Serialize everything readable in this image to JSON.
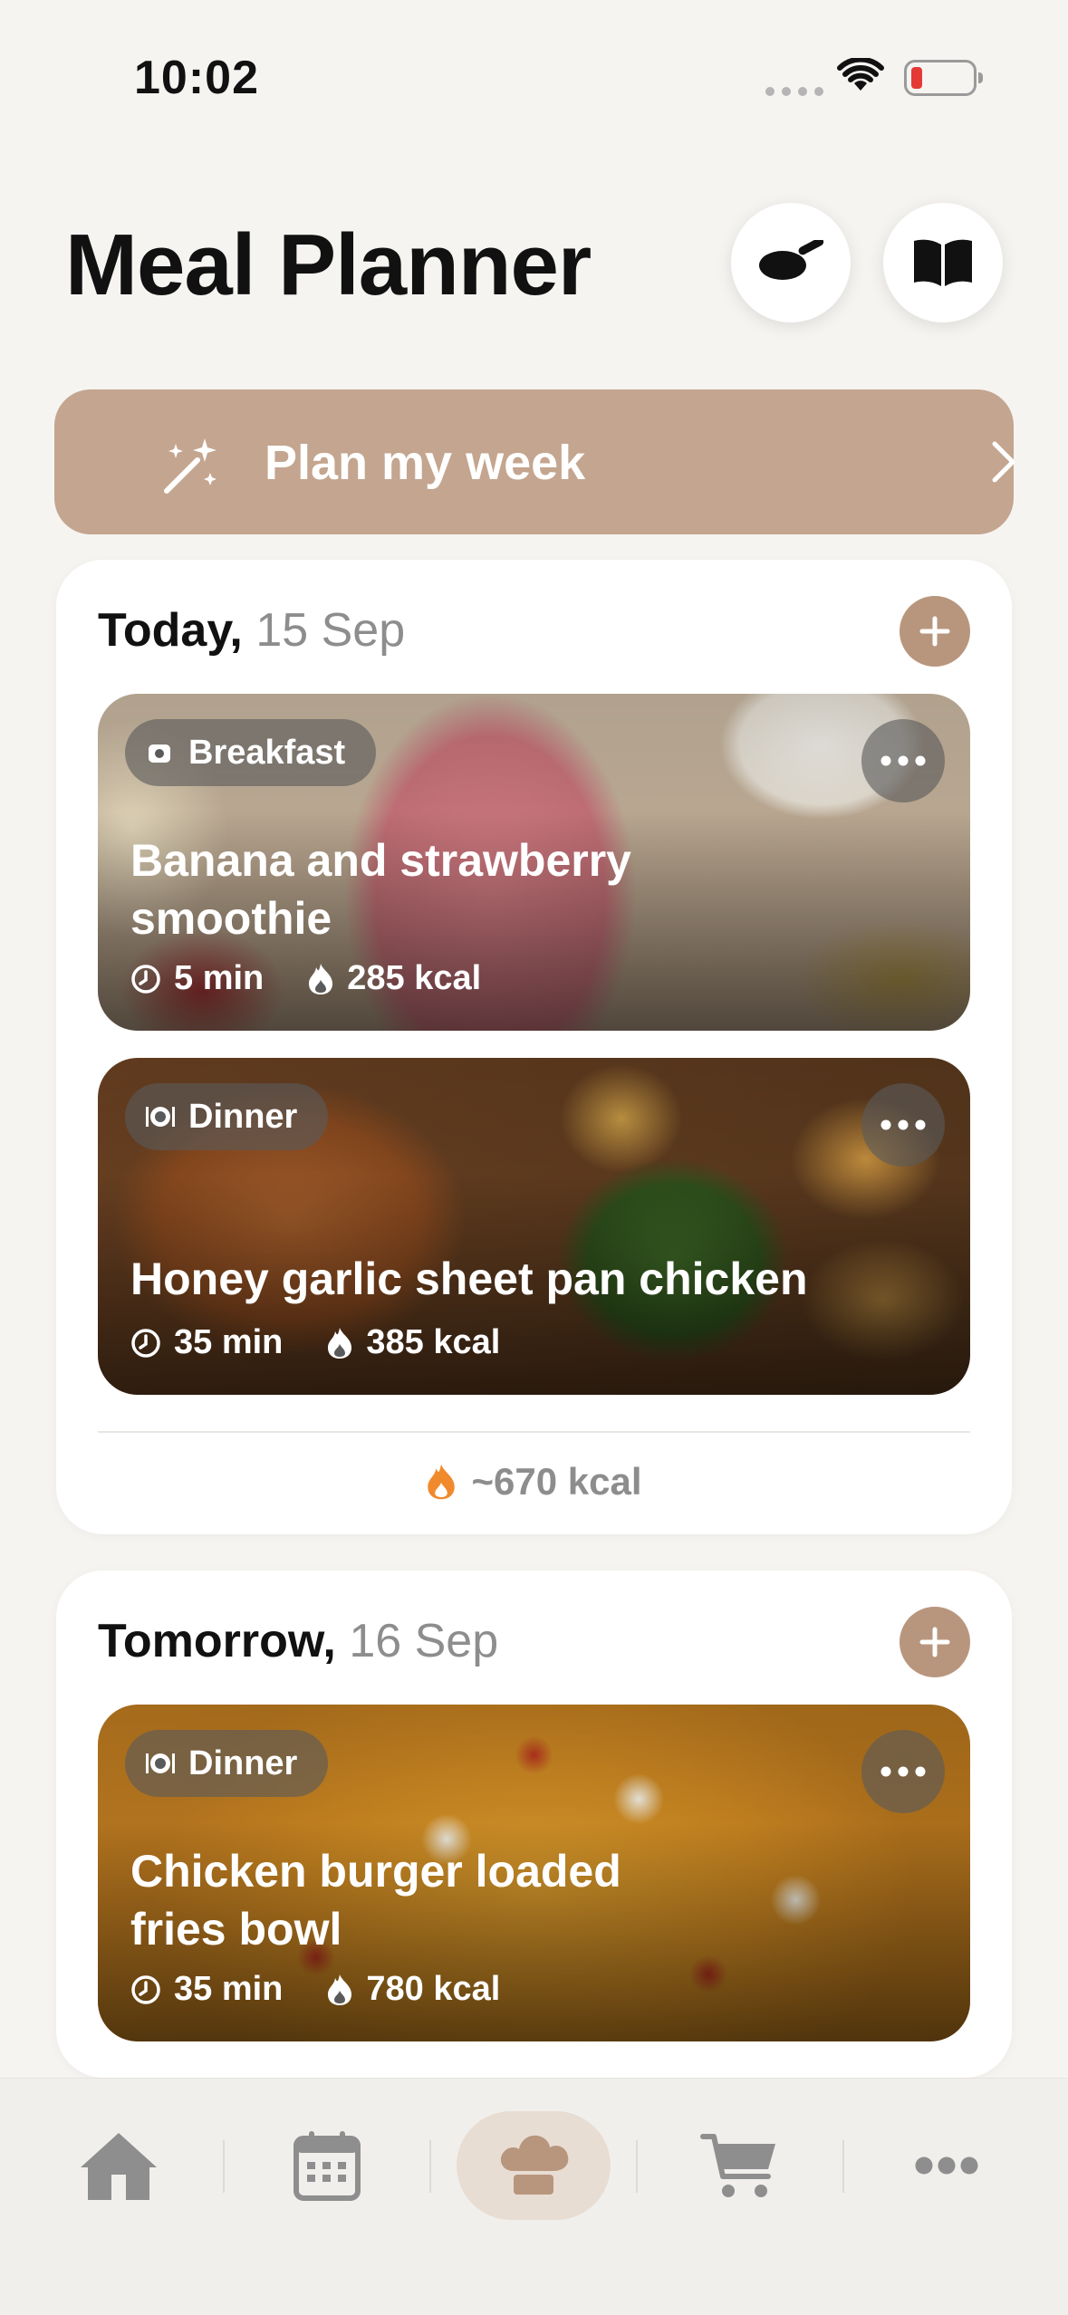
{
  "status_bar": {
    "time": "10:02"
  },
  "header": {
    "title": "Meal Planner"
  },
  "plan_button": {
    "label": "Plan my week"
  },
  "days": [
    {
      "label": "Today,",
      "date": "15 Sep",
      "meals": [
        {
          "type": "Breakfast",
          "title": "Banana and strawberry smoothie",
          "time": "5 min",
          "kcal": "285 kcal"
        },
        {
          "type": "Dinner",
          "title": "Honey garlic sheet pan chicken",
          "time": "35 min",
          "kcal": "385 kcal"
        }
      ],
      "total": "~670 kcal"
    },
    {
      "label": "Tomorrow,",
      "date": "16 Sep",
      "meals": [
        {
          "type": "Dinner",
          "title": "Chicken burger loaded fries bowl",
          "time": "35 min",
          "kcal": "780 kcal"
        }
      ]
    }
  ],
  "tabs": [
    {
      "icon": "home-icon"
    },
    {
      "icon": "calendar-icon"
    },
    {
      "icon": "chef-hat-icon",
      "active": true
    },
    {
      "icon": "cart-icon"
    },
    {
      "icon": "more-icon"
    }
  ],
  "colors": {
    "accent": "#c4a58f",
    "add_button": "#b8967d",
    "background": "#f6f4f1",
    "flame": "#f08a2c"
  }
}
